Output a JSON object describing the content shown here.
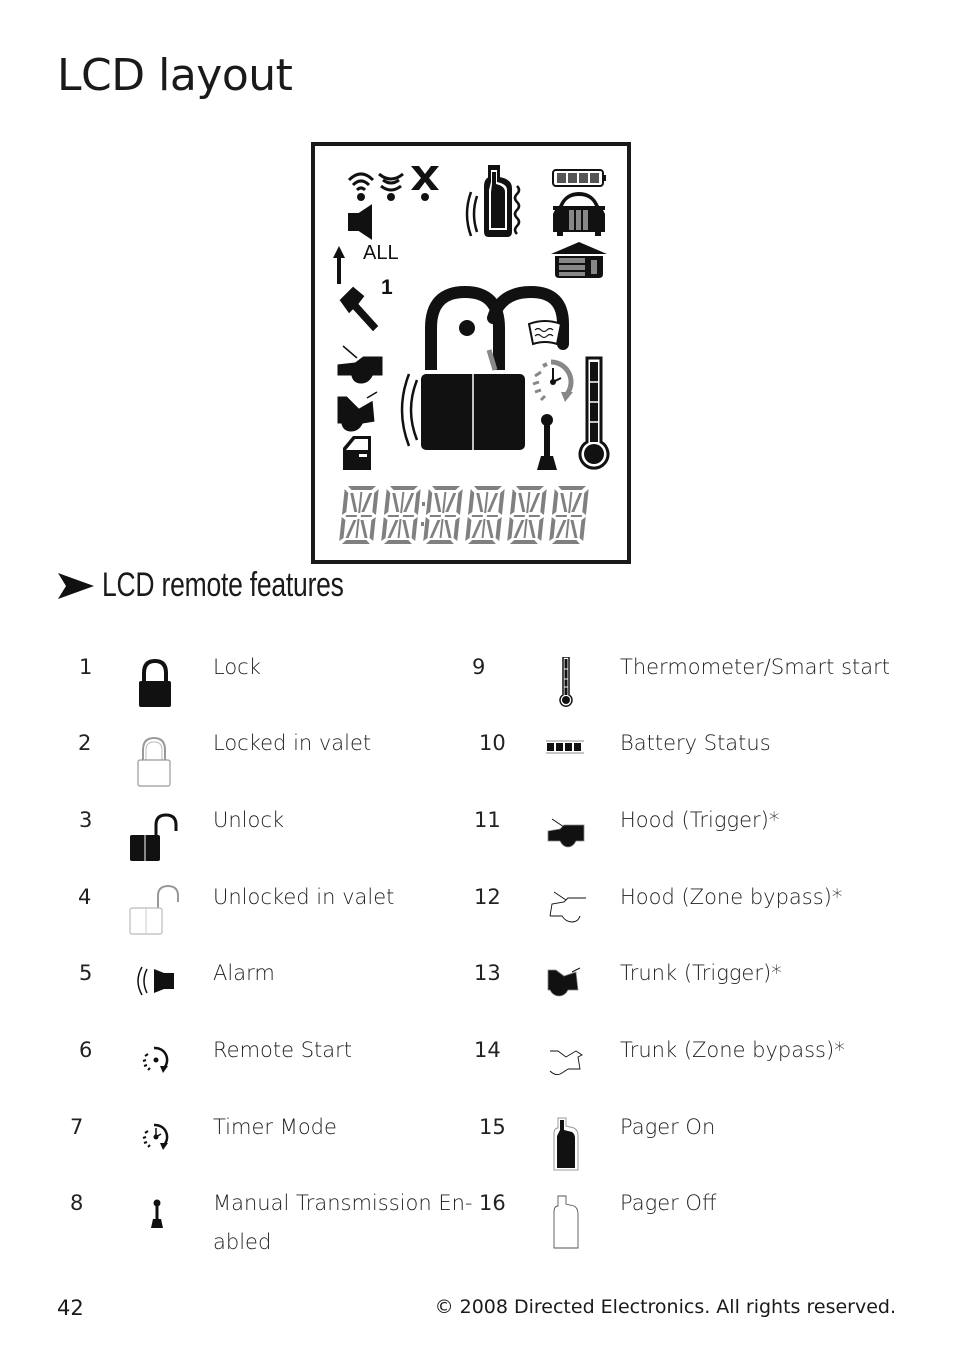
{
  "page_title": "LCD layout",
  "lcd": {
    "all_label": "ALL",
    "one_label": "1",
    "battery_level": 1.0,
    "icons": [
      "signal-transmit-icon",
      "signal-receive-icon",
      "out-of-range-icon",
      "speaker-icon",
      "pager-vibrate-icon",
      "battery-icon",
      "car-front-icon",
      "garage-icon",
      "arrow-up-icon",
      "hammer-icon",
      "hood-icon",
      "trunk-icon",
      "door-icon",
      "alarm-waves-icon",
      "padlock-icon",
      "windshield-icon",
      "timer-icon",
      "thermometer-icon",
      "manual-transmission-icon",
      "segment-display"
    ]
  },
  "section_heading": "LCD remote features",
  "features_left": [
    {
      "num": "1",
      "label": "Lock",
      "icon": "lock-icon"
    },
    {
      "num": "2",
      "label": "Locked in valet",
      "icon": "lock-valet-icon"
    },
    {
      "num": "3",
      "label": "Unlock",
      "icon": "unlock-icon"
    },
    {
      "num": "4",
      "label": "Unlocked in valet",
      "icon": "unlock-valet-icon"
    },
    {
      "num": "5",
      "label": "Alarm",
      "icon": "alarm-icon"
    },
    {
      "num": "6",
      "label": "Remote Start",
      "icon": "remote-start-icon"
    },
    {
      "num": "7",
      "label": "Timer Mode",
      "icon": "timer-mode-icon"
    },
    {
      "num": "8",
      "label": "Manual Transmission En-",
      "label2": "abled",
      "icon": "manual-transmission-icon"
    }
  ],
  "features_right": [
    {
      "num": "9",
      "label": "Thermometer/Smart start",
      "icon": "thermometer-icon"
    },
    {
      "num": "10",
      "label": "Battery Status",
      "icon": "battery-status-icon"
    },
    {
      "num": "11",
      "label": "Hood (Trigger)*",
      "icon": "hood-trigger-icon"
    },
    {
      "num": "12",
      "label": "Hood (Zone bypass)*",
      "icon": "hood-bypass-icon"
    },
    {
      "num": "13",
      "label": "Trunk (Trigger)*",
      "icon": "trunk-trigger-icon"
    },
    {
      "num": "14",
      "label": "Trunk (Zone bypass)*",
      "icon": "trunk-bypass-icon"
    },
    {
      "num": "15",
      "label": "Pager On",
      "icon": "pager-on-icon"
    },
    {
      "num": "16",
      "label": "Pager Off",
      "icon": "pager-off-icon"
    }
  ],
  "footer": {
    "page_number": "42",
    "copyright": "© 2008 Directed Electronics. All rights reserved."
  }
}
